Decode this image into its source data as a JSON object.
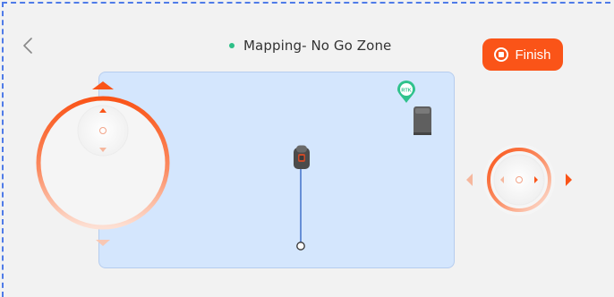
{
  "header": {
    "title": "Mapping- No Go Zone",
    "status_color": "#2dbf87"
  },
  "finish_button": {
    "label": "Finish",
    "color": "#fa5418"
  },
  "map": {
    "background": "#d4e6fd",
    "rtk_label": "RTK",
    "icons": [
      "rtk-pin-icon",
      "charging-station-icon",
      "mower-icon"
    ]
  },
  "controls": {
    "left_joystick": "vertical-joystick",
    "right_joystick": "horizontal-joystick",
    "accent": "#fa5418"
  }
}
